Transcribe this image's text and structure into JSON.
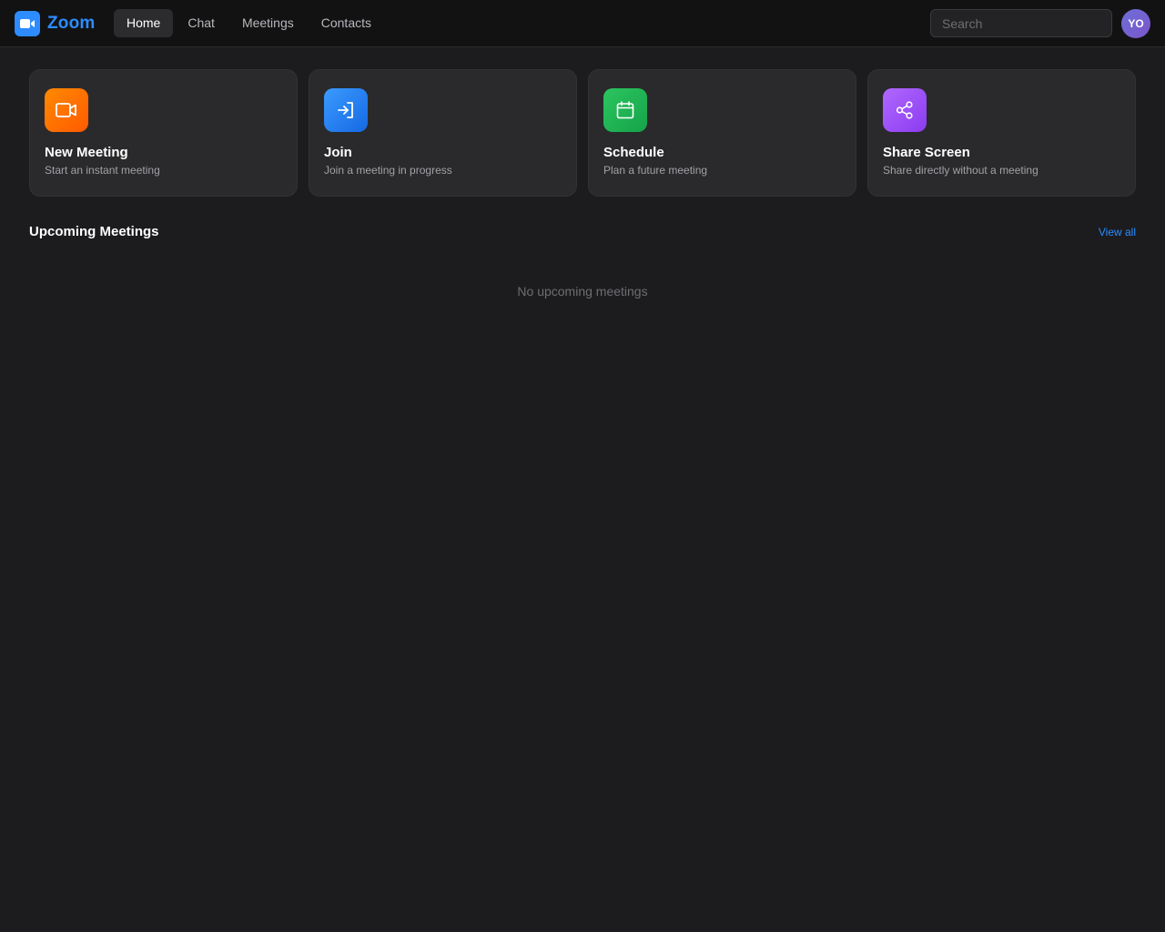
{
  "app": {
    "name": "Zoom",
    "accent": "#2d8cff"
  },
  "nav": {
    "tabs": [
      {
        "label": "Home",
        "active": true
      },
      {
        "label": "Chat",
        "active": false
      },
      {
        "label": "Meetings",
        "active": false
      },
      {
        "label": "Contacts",
        "active": false
      }
    ]
  },
  "search": {
    "placeholder": "Search",
    "value": ""
  },
  "user": {
    "initials": "YO"
  },
  "actions": [
    {
      "title": "New Meeting",
      "subtitle": "Start an instant meeting",
      "icon": "video-camera-icon",
      "color": "#ff6d00"
    },
    {
      "title": "Join",
      "subtitle": "Join a meeting in progress",
      "icon": "sign-in-icon",
      "color": "#2d8cff"
    },
    {
      "title": "Schedule",
      "subtitle": "Plan a future meeting",
      "icon": "calendar-icon",
      "color": "#22c55e"
    },
    {
      "title": "Share Screen",
      "subtitle": "Share directly without a meeting",
      "icon": "share-icon",
      "color": "#a855f7"
    }
  ],
  "upcoming": {
    "title": "Upcoming Meetings",
    "view_all_label": "View all",
    "empty_text": "No upcoming meetings"
  }
}
